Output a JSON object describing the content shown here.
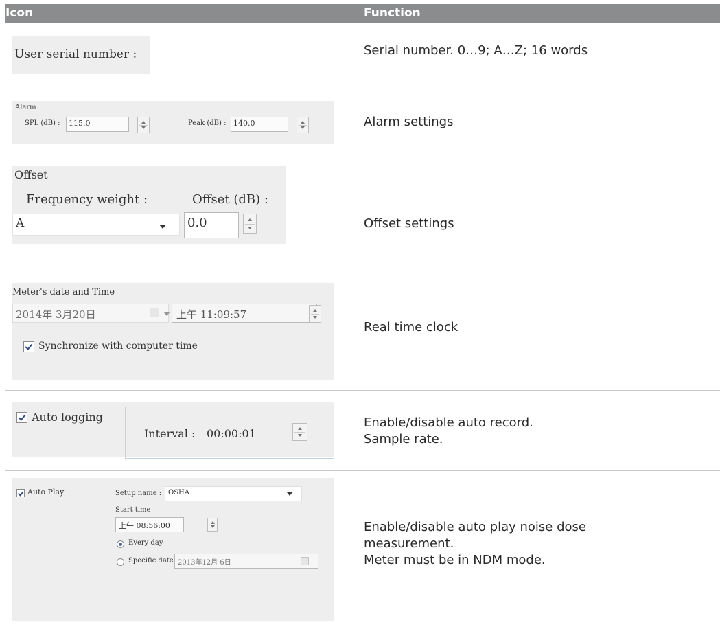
{
  "header": {
    "col_icon": "Icon",
    "col_function": "Function"
  },
  "rows": [
    {
      "ui": {
        "label": "User serial number :"
      },
      "function": [
        "Serial number. 0…9; A…Z; 16 words"
      ]
    },
    {
      "ui": {
        "group": "Alarm",
        "spl_label": "SPL (dB) :",
        "spl_value": "115.0",
        "peak_label": "Peak (dB) :",
        "peak_value": "140.0"
      },
      "function": [
        "Alarm settings"
      ]
    },
    {
      "ui": {
        "group": "Offset",
        "freq_label": "Frequency weight :",
        "offset_label": "Offset (dB) :",
        "freq_value": "A",
        "offset_value": "0.0"
      },
      "function": [
        "Offset settings"
      ]
    },
    {
      "ui": {
        "group": "Meter's date and Time",
        "date_value": "2014年  3月20日",
        "time_value": "上午 11:09:57",
        "sync_label": "Synchronize with computer time"
      },
      "function": [
        "Real time clock"
      ]
    },
    {
      "ui": {
        "auto_logging": "Auto logging",
        "interval_label": "Interval :",
        "interval_value": "00:00:01"
      },
      "function": [
        "Enable/disable auto record.",
        "Sample rate."
      ]
    },
    {
      "ui": {
        "auto_play": "Auto Play",
        "setup_label": "Setup name :",
        "setup_value": "OSHA",
        "start_label": "Start time",
        "start_value": "上午 08:56:00",
        "every_day": "Every day",
        "specific_date": "Specific date",
        "specific_value": "2013年12月  6日"
      },
      "function": [
        "Enable/disable auto play noise dose",
        "measurement.",
        "Meter must be in NDM mode."
      ]
    }
  ]
}
